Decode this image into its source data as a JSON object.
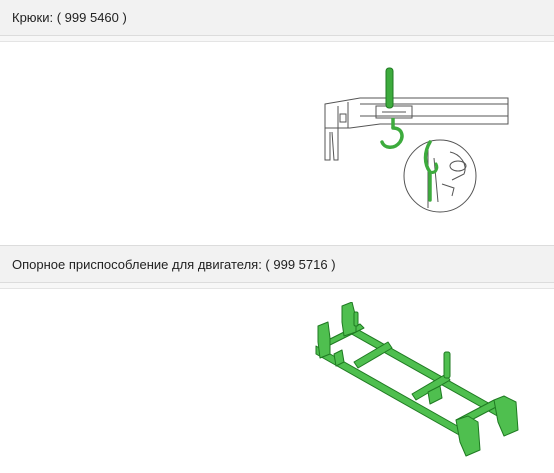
{
  "sections": [
    {
      "title": "Крюки: ( 999 5460 )",
      "illustration": "hooks-tool-diagram"
    },
    {
      "title": "Опорное приспособление для двигателя: ( 999 5716 )",
      "illustration": "engine-support-fixture"
    }
  ],
  "colors": {
    "header_bg": "#f2f2f2",
    "tool_green": "#3dab3d",
    "tool_green_dark": "#1f7a22",
    "line_gray": "#555555"
  }
}
